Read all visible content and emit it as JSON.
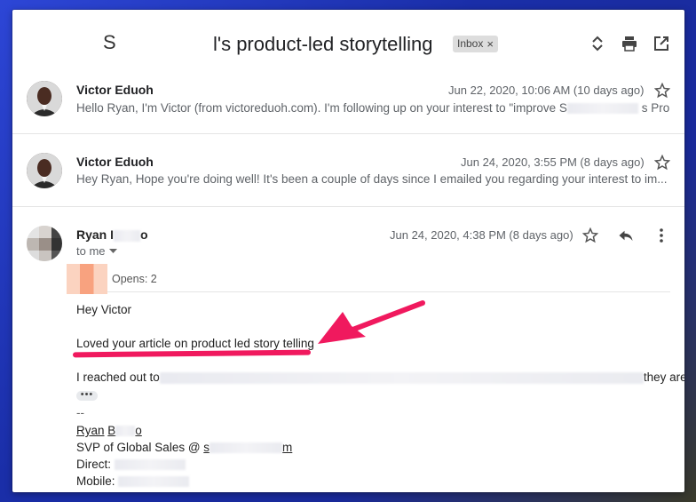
{
  "thread": {
    "lead_fragment": "S",
    "subject": "l's product-led storytelling",
    "label": "Inbox",
    "label_remove": "×"
  },
  "header_icons": [
    "expand-collapse-icon",
    "print-icon",
    "open-in-new-window-icon"
  ],
  "messages": [
    {
      "sender": "Victor Eduoh",
      "date": "Jun 22, 2020, 10:06 AM (10 days ago)",
      "snippet_start": "Hello Ryan, I'm Victor (from victoreduoh.com). I'm following up on your interest to \"improve S",
      "snippet_end": "s Pro..."
    },
    {
      "sender": "Victor Eduoh",
      "date": "Jun 24, 2020, 3:55 PM (8 days ago)",
      "snippet": "Hey Ryan, Hope you're doing well! It's been a couple of days since I emailed you regarding your interest to im..."
    }
  ],
  "expanded": {
    "sender_first": "Ryan",
    "sender_first_initial": "I",
    "sender_tail": "o",
    "date": "Jun 24, 2020, 4:38 PM (8 days ago)",
    "to": "to me",
    "opens": "Opens: 2",
    "greeting": "Hey Victor",
    "loved_line": "Loved your article on product led story telling",
    "reached_start": "I reached out to",
    "reached_end": "they are.",
    "dots": "•••",
    "sig_dash": "--",
    "sig_name_first": "Ryan",
    "sig_name_initial": "B",
    "sig_name_end": "o",
    "sig_title": "SVP of Global Sales @",
    "sig_at_start": "s",
    "sig_at_end": "m",
    "sig_direct": "Direct:",
    "sig_mobile": "Mobile:"
  },
  "colors": {
    "annotation": "#f0195e",
    "frame": "#1e33b8"
  }
}
